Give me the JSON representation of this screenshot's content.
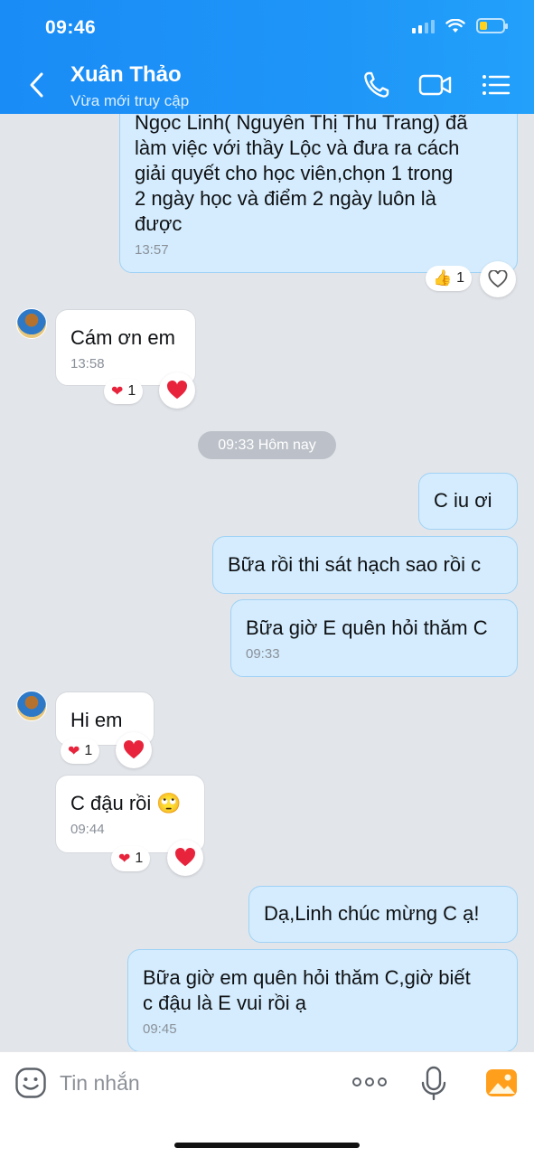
{
  "status_bar": {
    "time": "09:46"
  },
  "header": {
    "contact_name": "Xuân Thảo",
    "contact_status": "Vừa mới truy cập",
    "icons": [
      "back-icon",
      "phone-icon",
      "video-call-icon",
      "menu-list-icon"
    ]
  },
  "messages": [
    {
      "side": "me",
      "lines": [
        "Ngọc Linh( Nguyễn Thị Thu Trang) đã",
        "làm việc với thầy Lộc và đưa ra cách",
        "giải quyết cho học viên,chọn 1 trong",
        "2 ngày học và điểm 2 ngày luôn là",
        "được"
      ],
      "time": "13:57",
      "reaction": {
        "emoji": "👍",
        "count": "1"
      }
    },
    {
      "side": "them",
      "text": "Cám ơn em",
      "time": "13:58",
      "reaction": {
        "emoji": "❤",
        "count": "1"
      }
    },
    {
      "side": "me",
      "text": "C iu ơi"
    },
    {
      "side": "me",
      "text": "Bữa rồi thi sát hạch sao rồi c"
    },
    {
      "side": "me",
      "text": "Bữa giờ E quên hỏi thăm C",
      "time": "09:33"
    },
    {
      "side": "them",
      "text": "Hi em",
      "reaction": {
        "emoji": "❤",
        "count": "1"
      }
    },
    {
      "side": "them",
      "text": "C đậu rồi",
      "time": "09:44",
      "emoji": "🙄",
      "reaction": {
        "emoji": "❤",
        "count": "1"
      }
    },
    {
      "side": "me",
      "text": "Dạ,Linh chúc mừng C ạ!"
    },
    {
      "side": "me",
      "lines": [
        "Bữa giờ em quên hỏi thăm C,giờ biết",
        "c đậu là E vui rồi ạ"
      ],
      "time": "09:45"
    }
  ],
  "date_divider": "09:33 Hôm nay",
  "composer": {
    "placeholder": "Tin nhắn",
    "icons": [
      "emoji-sticker-icon",
      "more-options-icon",
      "microphone-icon",
      "photo-gallery-icon"
    ]
  },
  "colors": {
    "header": "#1e95f8",
    "my_bubble": "#d4ecfd",
    "their_bubble": "#ffffff",
    "background": "#e2e5ea",
    "heart": "#e8243c"
  }
}
